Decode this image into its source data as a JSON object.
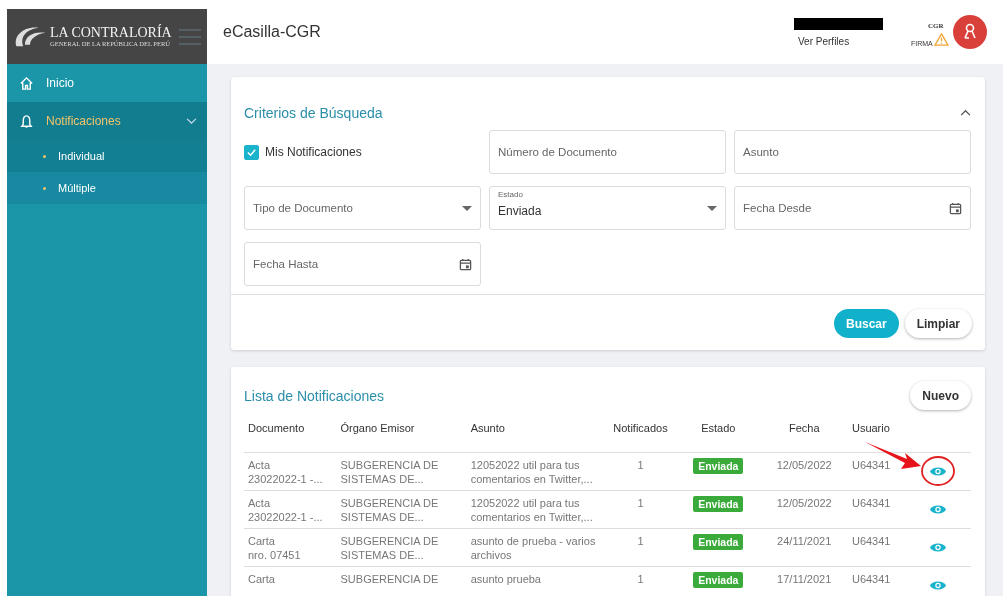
{
  "sidebar": {
    "logo": {
      "title": "LA CONTRALORÍA",
      "subtitle": "GENERAL DE LA REPÚBLICA DEL PERÚ"
    },
    "items": [
      {
        "label": "Inicio",
        "selected": false
      },
      {
        "label": "Notificaciones",
        "selected": true,
        "expanded": true,
        "children": [
          {
            "label": "Individual",
            "selected": true
          },
          {
            "label": "Múltiple",
            "selected": false
          }
        ]
      }
    ]
  },
  "header": {
    "title": "eCasilla-CGR",
    "profile_link": "Ver Perfiles",
    "badge": {
      "top": "CGR",
      "bottom": "FIRMA"
    }
  },
  "search": {
    "title": "Criterios de Búsqueda",
    "expanded": true,
    "fields": [
      {
        "kind": "checkbox",
        "label": "Mis Notificaciones",
        "checked": true
      },
      {
        "kind": "text",
        "placeholder": "Número de Documento"
      },
      {
        "kind": "text",
        "placeholder": "Asunto"
      },
      {
        "kind": "select",
        "placeholder": "Tipo de Documento"
      },
      {
        "kind": "select",
        "label": "Estado",
        "value": "Enviada"
      },
      {
        "kind": "date",
        "placeholder": "Fecha Desde"
      },
      {
        "kind": "date",
        "placeholder": "Fecha Hasta"
      }
    ],
    "buttons": [
      {
        "label": "Buscar",
        "kind": "primary"
      },
      {
        "label": "Limpiar",
        "kind": "secondary"
      }
    ]
  },
  "list": {
    "title": "Lista de Notificaciones",
    "new_button": "Nuevo",
    "columns": [
      "Documento",
      "Órgano Emisor",
      "Asunto",
      "Notificados",
      "Estado",
      "Fecha",
      "Usuario"
    ],
    "rows": [
      {
        "documento": "Acta\n23022022-1 -...",
        "organo": "SUBGERENCIA DE\nSISTEMAS DE...",
        "asunto": "12052022 util para tus\ncomentarios en Twitter,...",
        "notificados": "1",
        "estado": "Enviada",
        "fecha": "12/05/2022",
        "usuario": "U64341",
        "highlighted": true
      },
      {
        "documento": "Acta\n23022022-1 -...",
        "organo": "SUBGERENCIA DE\nSISTEMAS DE...",
        "asunto": "12052022 util para tus\ncomentarios en Twitter,...",
        "notificados": "1",
        "estado": "Enviada",
        "fecha": "12/05/2022",
        "usuario": "U64341",
        "highlighted": false
      },
      {
        "documento": "Carta\nnro. 07451",
        "organo": "SUBGERENCIA DE\nSISTEMAS DE...",
        "asunto": "asunto de prueba - varios\narchivos",
        "notificados": "1",
        "estado": "Enviada",
        "fecha": "24/11/2021",
        "usuario": "U64341",
        "highlighted": false
      },
      {
        "documento": "Carta",
        "organo": "SUBGERENCIA DE",
        "asunto": "asunto prueba",
        "notificados": "1",
        "estado": "Enviada",
        "fecha": "17/11/2021",
        "usuario": "U64341",
        "highlighted": false
      }
    ]
  }
}
